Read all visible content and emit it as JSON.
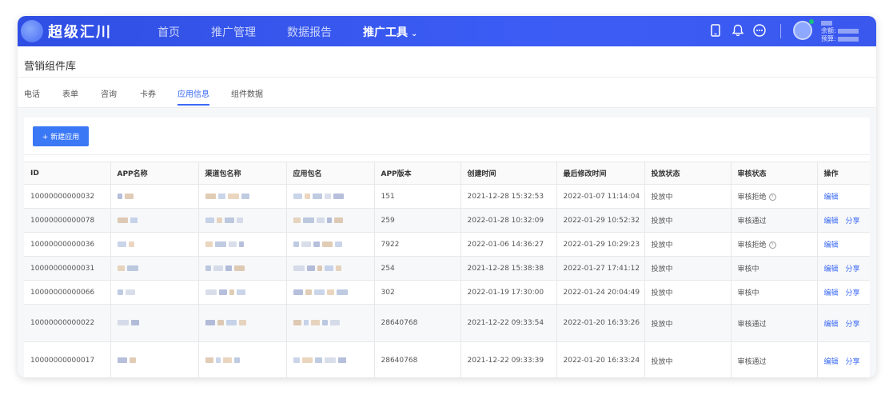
{
  "app": {
    "logo_text": "超级汇川"
  },
  "nav": {
    "items": [
      "首页",
      "推广管理",
      "数据报告",
      "推广工具"
    ],
    "active_index": 3
  },
  "account": {
    "balance_label": "余额:",
    "budget_label": "预算:"
  },
  "page": {
    "title": "营销组件库",
    "tabs": [
      "电话",
      "表单",
      "咨询",
      "卡券",
      "应用信息",
      "组件数据"
    ],
    "active_tab_index": 4,
    "new_button_label": "+ 新建应用"
  },
  "table": {
    "columns": [
      "ID",
      "APP名称",
      "渠道包名称",
      "应用包名",
      "APP版本",
      "创建时间",
      "最后修改时间",
      "投放状态",
      "审核状态",
      "操作"
    ],
    "rows": [
      {
        "id": "10000000000032",
        "version": "151",
        "created": "2021-12-28 15:32:53",
        "modified": "2022-01-07 11:14:04",
        "delivery": "投放中",
        "review": "审核拒绝",
        "has_help": true,
        "actions": [
          "编辑"
        ]
      },
      {
        "id": "10000000000078",
        "version": "259",
        "created": "2022-01-28 10:32:09",
        "modified": "2022-01-29 10:52:32",
        "delivery": "投放中",
        "review": "审核通过",
        "has_help": false,
        "actions": [
          "编辑",
          "分享"
        ]
      },
      {
        "id": "10000000000036",
        "version": "7922",
        "created": "2022-01-06 14:36:27",
        "modified": "2022-01-29 10:29:23",
        "delivery": "投放中",
        "review": "审核拒绝",
        "has_help": true,
        "actions": [
          "编辑"
        ]
      },
      {
        "id": "10000000000031",
        "version": "254",
        "created": "2021-12-28 15:38:38",
        "modified": "2022-01-27 17:41:12",
        "delivery": "投放中",
        "review": "审核中",
        "has_help": false,
        "actions": [
          "编辑",
          "分享"
        ]
      },
      {
        "id": "10000000000066",
        "version": "302",
        "created": "2022-01-19 17:30:00",
        "modified": "2022-01-24 20:04:49",
        "delivery": "投放中",
        "review": "审核中",
        "has_help": false,
        "actions": [
          "编辑",
          "分享"
        ]
      },
      {
        "id": "10000000000022",
        "version": "28640768",
        "created": "2021-12-22 09:33:54",
        "modified": "2022-01-20 16:33:26",
        "delivery": "投放中",
        "review": "审核通过",
        "has_help": false,
        "actions": [
          "编辑",
          "分享"
        ]
      },
      {
        "id": "10000000000017",
        "version": "28640768",
        "created": "2021-12-22 09:33:39",
        "modified": "2022-01-20 16:33:24",
        "delivery": "投放中",
        "review": "审核通过",
        "has_help": false,
        "actions": [
          "编辑",
          "分享"
        ]
      }
    ]
  },
  "colors": {
    "brand": "#3b6af6",
    "nav_bg": "#3c5df5"
  }
}
